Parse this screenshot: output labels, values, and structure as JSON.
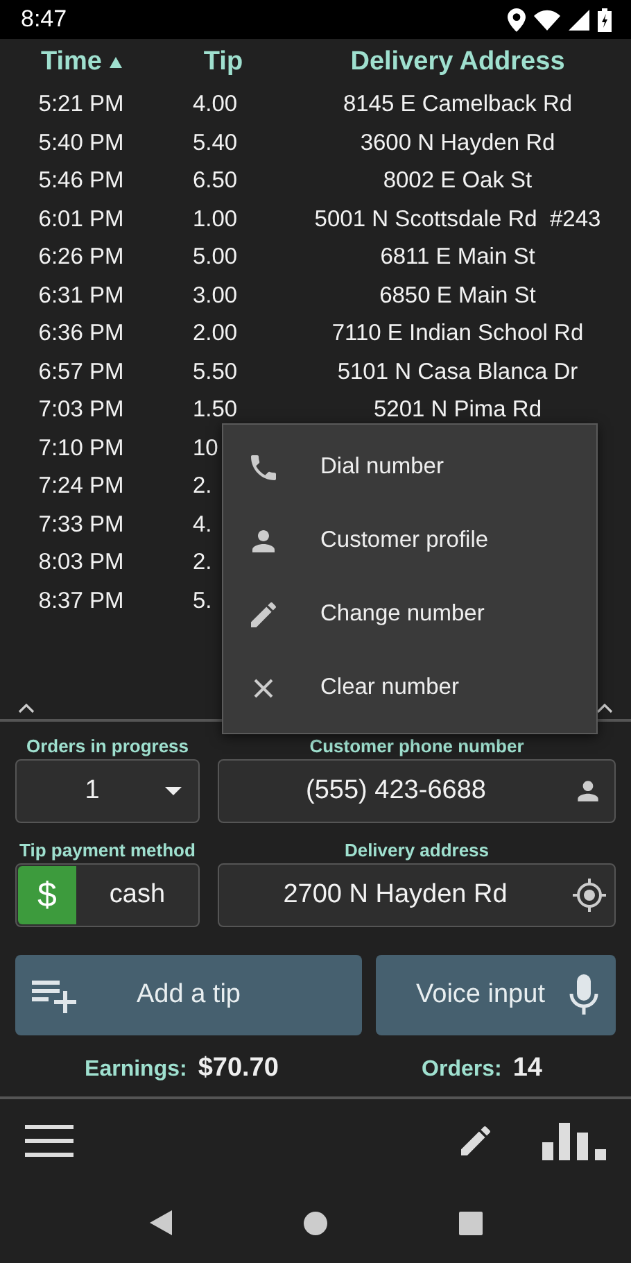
{
  "status_bar": {
    "time": "8:47"
  },
  "table": {
    "columns": [
      {
        "label": "Time",
        "sorted": true
      },
      {
        "label": "Tip",
        "sorted": false
      },
      {
        "label": "Delivery Address",
        "sorted": false
      }
    ],
    "rows": [
      {
        "time": "5:21 PM",
        "tip": "4.00",
        "address": "8145 E Camelback Rd"
      },
      {
        "time": "5:40 PM",
        "tip": "5.40",
        "address": "3600 N Hayden Rd"
      },
      {
        "time": "5:46 PM",
        "tip": "6.50",
        "address": "8002 E Oak St"
      },
      {
        "time": "6:01 PM",
        "tip": "1.00",
        "address": "5001 N Scottsdale Rd  #243"
      },
      {
        "time": "6:26 PM",
        "tip": "5.00",
        "address": "6811 E Main St"
      },
      {
        "time": "6:31 PM",
        "tip": "3.00",
        "address": "6850 E Main St"
      },
      {
        "time": "6:36 PM",
        "tip": "2.00",
        "address": "7110 E Indian School Rd"
      },
      {
        "time": "6:57 PM",
        "tip": "5.50",
        "address": "5101 N Casa Blanca Dr"
      },
      {
        "time": "7:03 PM",
        "tip": "1.50",
        "address": "5201 N Pima Rd"
      },
      {
        "time": "7:10 PM",
        "tip": "10"
      },
      {
        "time": "7:24 PM",
        "tip": "2."
      },
      {
        "time": "7:33 PM",
        "tip": "4."
      },
      {
        "time": "8:03 PM",
        "tip": "2."
      },
      {
        "time": "8:37 PM",
        "tip": "5."
      }
    ]
  },
  "context_menu": {
    "items": [
      {
        "kind": "phone",
        "label": "Dial number"
      },
      {
        "kind": "person",
        "label": "Customer profile"
      },
      {
        "kind": "pencil",
        "label": "Change number"
      },
      {
        "kind": "close",
        "label": "Clear number"
      }
    ]
  },
  "form": {
    "orders_in_progress": {
      "label": "Orders in progress",
      "value": "1"
    },
    "customer_phone": {
      "label": "Customer phone number",
      "value": "(555) 423-6688"
    },
    "tip_payment_method": {
      "label": "Tip payment method",
      "symbol": "$",
      "value": "cash"
    },
    "delivery_address": {
      "label": "Delivery address",
      "value": "2700 N Hayden Rd"
    }
  },
  "actions": [
    {
      "kind": "add",
      "label": "Add a tip"
    },
    {
      "kind": "voice",
      "label": "Voice input"
    }
  ],
  "summary": {
    "earnings_label": "Earnings:",
    "earnings": "$70.70",
    "orders_label": "Orders:",
    "orders": "14"
  }
}
